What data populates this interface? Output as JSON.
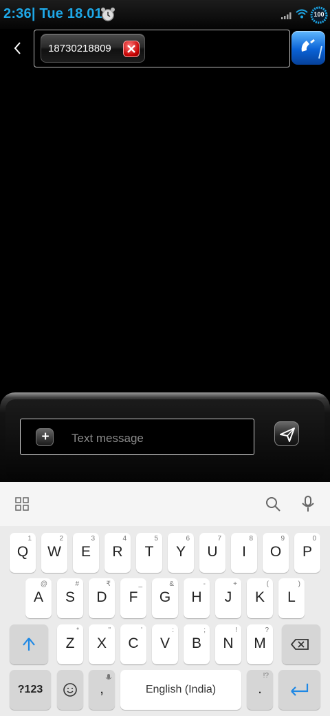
{
  "status": {
    "time": "2:36| Tue 18.01",
    "battery": "100"
  },
  "header": {
    "recipient": "18730218809"
  },
  "compose": {
    "placeholder": "Text message"
  },
  "keyboard": {
    "row1": [
      {
        "key": "Q",
        "hint": "1"
      },
      {
        "key": "W",
        "hint": "2"
      },
      {
        "key": "E",
        "hint": "3"
      },
      {
        "key": "R",
        "hint": "4"
      },
      {
        "key": "T",
        "hint": "5"
      },
      {
        "key": "Y",
        "hint": "6"
      },
      {
        "key": "U",
        "hint": "7"
      },
      {
        "key": "I",
        "hint": "8"
      },
      {
        "key": "O",
        "hint": "9"
      },
      {
        "key": "P",
        "hint": "0"
      }
    ],
    "row2": [
      {
        "key": "A",
        "hint": "@"
      },
      {
        "key": "S",
        "hint": "#"
      },
      {
        "key": "D",
        "hint": "₹"
      },
      {
        "key": "F",
        "hint": "_"
      },
      {
        "key": "G",
        "hint": "&"
      },
      {
        "key": "H",
        "hint": "-"
      },
      {
        "key": "J",
        "hint": "+"
      },
      {
        "key": "K",
        "hint": "("
      },
      {
        "key": "L",
        "hint": ")"
      }
    ],
    "row3": [
      {
        "key": "Z",
        "hint": "*"
      },
      {
        "key": "X",
        "hint": "\""
      },
      {
        "key": "C",
        "hint": "'"
      },
      {
        "key": "V",
        "hint": ":"
      },
      {
        "key": "B",
        "hint": ";"
      },
      {
        "key": "N",
        "hint": "!"
      },
      {
        "key": "M",
        "hint": "?"
      }
    ],
    "symbols_key": "?123",
    "comma_key": ",",
    "space_key": "English (India)",
    "period_key": ".",
    "period_hint": "!?"
  }
}
